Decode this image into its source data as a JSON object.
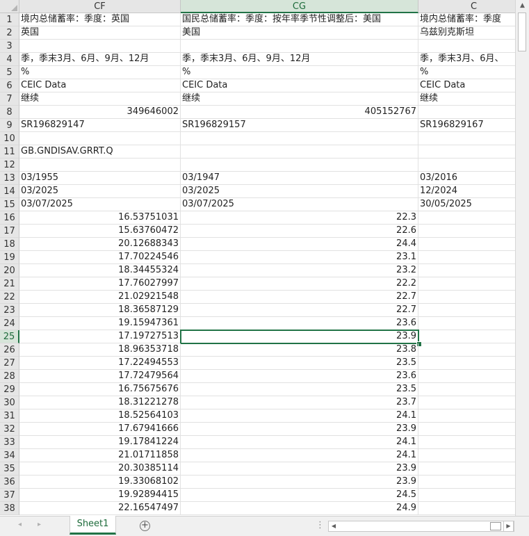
{
  "columns": [
    {
      "label": "CF",
      "active": false
    },
    {
      "label": "CG",
      "active": true
    },
    {
      "label": "C",
      "active": false
    }
  ],
  "active_row": 25,
  "rows": [
    {
      "n": 1,
      "cells": [
        {
          "v": "境内总储蓄率：季度：英国"
        },
        {
          "v": "国民总储蓄率：季度：按年率季节性调整后：美国"
        },
        {
          "v": "境内总储蓄率：季度"
        }
      ]
    },
    {
      "n": 2,
      "cells": [
        {
          "v": "英国"
        },
        {
          "v": "美国"
        },
        {
          "v": "乌兹别克斯坦"
        }
      ]
    },
    {
      "n": 3,
      "cells": [
        {
          "v": ""
        },
        {
          "v": ""
        },
        {
          "v": ""
        }
      ]
    },
    {
      "n": 4,
      "cells": [
        {
          "v": "季，季末3月、6月、9月、12月"
        },
        {
          "v": "季，季末3月、6月、9月、12月"
        },
        {
          "v": "季，季末3月、6月、"
        }
      ]
    },
    {
      "n": 5,
      "cells": [
        {
          "v": "%"
        },
        {
          "v": "%"
        },
        {
          "v": "%"
        }
      ]
    },
    {
      "n": 6,
      "cells": [
        {
          "v": "CEIC Data"
        },
        {
          "v": "CEIC Data"
        },
        {
          "v": "CEIC Data"
        }
      ]
    },
    {
      "n": 7,
      "cells": [
        {
          "v": "继续"
        },
        {
          "v": "继续"
        },
        {
          "v": "继续"
        }
      ]
    },
    {
      "n": 8,
      "cells": [
        {
          "v": "349646002",
          "num": true
        },
        {
          "v": "405152767",
          "num": true
        },
        {
          "v": ""
        }
      ]
    },
    {
      "n": 9,
      "cells": [
        {
          "v": "SR196829147"
        },
        {
          "v": "SR196829157"
        },
        {
          "v": "SR196829167"
        }
      ]
    },
    {
      "n": 10,
      "cells": [
        {
          "v": ""
        },
        {
          "v": ""
        },
        {
          "v": ""
        }
      ]
    },
    {
      "n": 11,
      "cells": [
        {
          "v": "GB.GNDISAV.GRRT.Q"
        },
        {
          "v": ""
        },
        {
          "v": ""
        }
      ]
    },
    {
      "n": 12,
      "cells": [
        {
          "v": ""
        },
        {
          "v": ""
        },
        {
          "v": ""
        }
      ]
    },
    {
      "n": 13,
      "cells": [
        {
          "v": "03/1955"
        },
        {
          "v": "03/1947"
        },
        {
          "v": "03/2016"
        }
      ]
    },
    {
      "n": 14,
      "cells": [
        {
          "v": "03/2025"
        },
        {
          "v": "03/2025"
        },
        {
          "v": "12/2024"
        }
      ]
    },
    {
      "n": 15,
      "cells": [
        {
          "v": "03/07/2025"
        },
        {
          "v": "03/07/2025"
        },
        {
          "v": "30/05/2025"
        }
      ]
    },
    {
      "n": 16,
      "cells": [
        {
          "v": "16.53751031",
          "num": true
        },
        {
          "v": "22.3",
          "num": true
        },
        {
          "v": ""
        }
      ]
    },
    {
      "n": 17,
      "cells": [
        {
          "v": "15.63760472",
          "num": true
        },
        {
          "v": "22.6",
          "num": true
        },
        {
          "v": ""
        }
      ]
    },
    {
      "n": 18,
      "cells": [
        {
          "v": "20.12688343",
          "num": true
        },
        {
          "v": "24.4",
          "num": true
        },
        {
          "v": ""
        }
      ]
    },
    {
      "n": 19,
      "cells": [
        {
          "v": "17.70224546",
          "num": true
        },
        {
          "v": "23.1",
          "num": true
        },
        {
          "v": ""
        }
      ]
    },
    {
      "n": 20,
      "cells": [
        {
          "v": "18.34455324",
          "num": true
        },
        {
          "v": "23.2",
          "num": true
        },
        {
          "v": ""
        }
      ]
    },
    {
      "n": 21,
      "cells": [
        {
          "v": "17.76027997",
          "num": true
        },
        {
          "v": "22.2",
          "num": true
        },
        {
          "v": ""
        }
      ]
    },
    {
      "n": 22,
      "cells": [
        {
          "v": "21.02921548",
          "num": true
        },
        {
          "v": "22.7",
          "num": true
        },
        {
          "v": ""
        }
      ]
    },
    {
      "n": 23,
      "cells": [
        {
          "v": "18.36587129",
          "num": true
        },
        {
          "v": "22.7",
          "num": true
        },
        {
          "v": ""
        }
      ]
    },
    {
      "n": 24,
      "cells": [
        {
          "v": "19.15947361",
          "num": true
        },
        {
          "v": "23.6",
          "num": true
        },
        {
          "v": ""
        }
      ]
    },
    {
      "n": 25,
      "cells": [
        {
          "v": "17.19727513",
          "num": true
        },
        {
          "v": "23.9",
          "num": true
        },
        {
          "v": ""
        }
      ]
    },
    {
      "n": 26,
      "cells": [
        {
          "v": "18.96353718",
          "num": true
        },
        {
          "v": "23.8",
          "num": true
        },
        {
          "v": ""
        }
      ]
    },
    {
      "n": 27,
      "cells": [
        {
          "v": "17.22494553",
          "num": true
        },
        {
          "v": "23.5",
          "num": true
        },
        {
          "v": ""
        }
      ]
    },
    {
      "n": 28,
      "cells": [
        {
          "v": "17.72479564",
          "num": true
        },
        {
          "v": "23.6",
          "num": true
        },
        {
          "v": ""
        }
      ]
    },
    {
      "n": 29,
      "cells": [
        {
          "v": "16.75675676",
          "num": true
        },
        {
          "v": "23.5",
          "num": true
        },
        {
          "v": ""
        }
      ]
    },
    {
      "n": 30,
      "cells": [
        {
          "v": "18.31221278",
          "num": true
        },
        {
          "v": "23.7",
          "num": true
        },
        {
          "v": ""
        }
      ]
    },
    {
      "n": 31,
      "cells": [
        {
          "v": "18.52564103",
          "num": true
        },
        {
          "v": "24.1",
          "num": true
        },
        {
          "v": ""
        }
      ]
    },
    {
      "n": 32,
      "cells": [
        {
          "v": "17.67941666",
          "num": true
        },
        {
          "v": "23.9",
          "num": true
        },
        {
          "v": ""
        }
      ]
    },
    {
      "n": 33,
      "cells": [
        {
          "v": "19.17841224",
          "num": true
        },
        {
          "v": "24.1",
          "num": true
        },
        {
          "v": ""
        }
      ]
    },
    {
      "n": 34,
      "cells": [
        {
          "v": "21.01711858",
          "num": true
        },
        {
          "v": "24.1",
          "num": true
        },
        {
          "v": ""
        }
      ]
    },
    {
      "n": 35,
      "cells": [
        {
          "v": "20.30385114",
          "num": true
        },
        {
          "v": "23.9",
          "num": true
        },
        {
          "v": ""
        }
      ]
    },
    {
      "n": 36,
      "cells": [
        {
          "v": "19.33068102",
          "num": true
        },
        {
          "v": "23.9",
          "num": true
        },
        {
          "v": ""
        }
      ]
    },
    {
      "n": 37,
      "cells": [
        {
          "v": "19.92894415",
          "num": true
        },
        {
          "v": "24.5",
          "num": true
        },
        {
          "v": ""
        }
      ]
    },
    {
      "n": 38,
      "cells": [
        {
          "v": "22.16547497",
          "num": true
        },
        {
          "v": "24.9",
          "num": true
        },
        {
          "v": ""
        }
      ]
    }
  ],
  "sheet_tabs": [
    {
      "label": "Sheet1",
      "active": true
    }
  ],
  "add_sheet_label": "+",
  "more_label": "⋮",
  "colors": {
    "accent": "#217346",
    "header_bg": "#e6e6e6",
    "active_header_bg": "#d6e5d9"
  },
  "icons": {
    "corner": "select-all-icon",
    "nav_prev": "chevron-left-icon",
    "nav_next": "chevron-right-icon",
    "add": "plus-circle-icon",
    "scroll_up": "triangle-up-icon",
    "scroll_down": "triangle-down-icon",
    "scroll_left": "triangle-left-icon",
    "scroll_right": "triangle-right-icon"
  }
}
